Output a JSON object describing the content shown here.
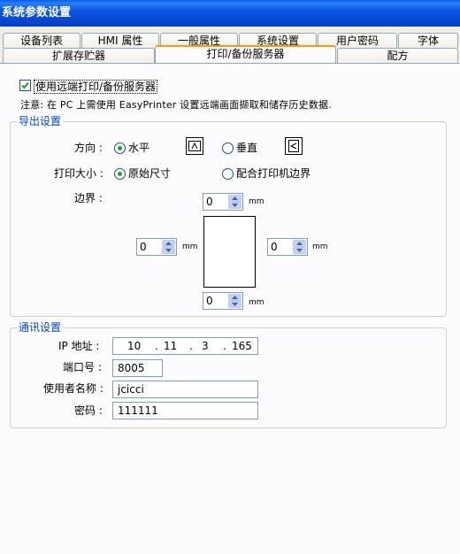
{
  "window": {
    "title": "系统参数设置"
  },
  "tabs_row1": [
    "设备列表",
    "HMI 属性",
    "一般属性",
    "系统设置",
    "用户密码",
    "字体"
  ],
  "tabs_row2": [
    "扩展存贮器",
    "打印/备份服务器",
    "配方"
  ],
  "active_tab": "打印/备份服务器",
  "enable": {
    "label": "使用远端打印/备份服务器",
    "checked": true
  },
  "note": "注意: 在 PC 上需使用 EasyPrinter 设置远端画面撷取和储存历史数据.",
  "export": {
    "legend": "导出设置",
    "direction_label": "方向 :",
    "direction_options": {
      "horizontal": "水平",
      "vertical": "垂直"
    },
    "direction_selected": "horizontal",
    "size_label": "打印大小 :",
    "size_options": {
      "original": "原始尺寸",
      "fit": "配合打印机边界"
    },
    "size_selected": "original",
    "margin_label": "边界 :",
    "margins": {
      "top": "0",
      "left": "0",
      "right": "0",
      "bottom": "0"
    },
    "unit": "mm"
  },
  "comm": {
    "legend": "通讯设置",
    "ip_label": "IP 地址 :",
    "ip": [
      "10",
      "11",
      "3",
      "165"
    ],
    "ip_sep": ".",
    "port_label": "端口号 :",
    "port": "8005",
    "user_label": "使用者名称 :",
    "user": "jcicci",
    "password_label": "密码 :",
    "password": "111111"
  }
}
